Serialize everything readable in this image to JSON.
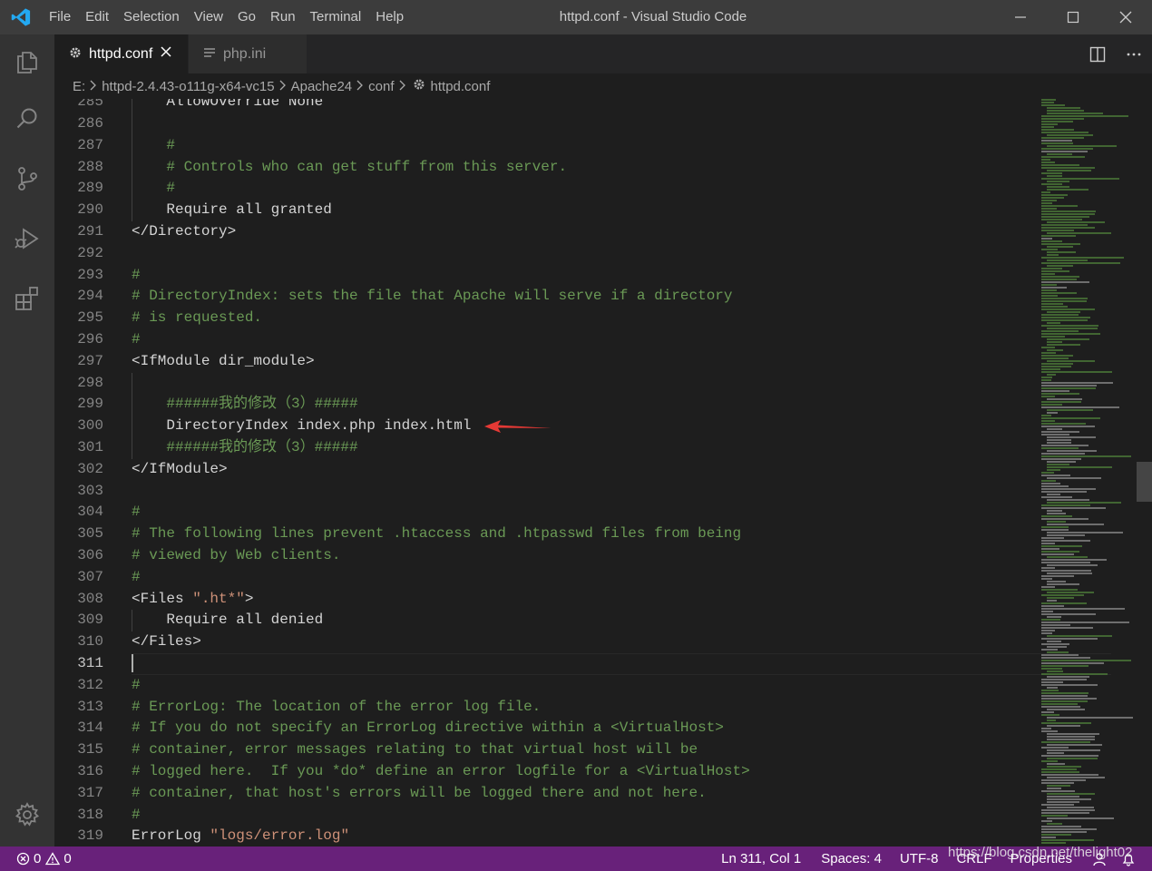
{
  "window": {
    "title": "httpd.conf - Visual Studio Code",
    "menu": [
      "File",
      "Edit",
      "Selection",
      "View",
      "Go",
      "Run",
      "Terminal",
      "Help"
    ]
  },
  "activity_bar": {
    "icons": [
      "explorer-icon",
      "search-icon",
      "source-control-icon",
      "run-debug-icon",
      "extensions-icon",
      "settings-gear-icon"
    ]
  },
  "tabs": [
    {
      "label": "httpd.conf",
      "active": true,
      "icon": "gear-file-icon"
    },
    {
      "label": "php.ini",
      "active": false,
      "icon": "lines-file-icon"
    }
  ],
  "breadcrumb": [
    "E:",
    "httpd-2.4.43-o111g-x64-vc15",
    "Apache24",
    "conf",
    "httpd.conf"
  ],
  "editor": {
    "first_line_partial": {
      "number": "285",
      "text": "AllowOverride None"
    },
    "lines": [
      {
        "n": "286",
        "indent": 0,
        "text": "",
        "kind": "code"
      },
      {
        "n": "287",
        "indent": 1,
        "text": "#",
        "kind": "comment"
      },
      {
        "n": "288",
        "indent": 1,
        "text": "# Controls who can get stuff from this server.",
        "kind": "comment"
      },
      {
        "n": "289",
        "indent": 1,
        "text": "#",
        "kind": "comment"
      },
      {
        "n": "290",
        "indent": 1,
        "text": "Require all granted",
        "kind": "code"
      },
      {
        "n": "291",
        "indent": 0,
        "text": "</Directory>",
        "kind": "code"
      },
      {
        "n": "292",
        "indent": 0,
        "text": "",
        "kind": "code"
      },
      {
        "n": "293",
        "indent": 0,
        "text": "#",
        "kind": "comment"
      },
      {
        "n": "294",
        "indent": 0,
        "text": "# DirectoryIndex: sets the file that Apache will serve if a directory",
        "kind": "comment"
      },
      {
        "n": "295",
        "indent": 0,
        "text": "# is requested.",
        "kind": "comment"
      },
      {
        "n": "296",
        "indent": 0,
        "text": "#",
        "kind": "comment"
      },
      {
        "n": "297",
        "indent": 0,
        "text": "<IfModule dir_module>",
        "kind": "code"
      },
      {
        "n": "298",
        "indent": 0,
        "text": "",
        "kind": "code"
      },
      {
        "n": "299",
        "indent": 1,
        "text": "######我的修改（3）#####",
        "kind": "comment"
      },
      {
        "n": "300",
        "indent": 1,
        "text": "DirectoryIndex index.php index.html",
        "kind": "code"
      },
      {
        "n": "301",
        "indent": 1,
        "text": "######我的修改（3）#####",
        "kind": "comment"
      },
      {
        "n": "302",
        "indent": 0,
        "text": "</IfModule>",
        "kind": "code"
      },
      {
        "n": "303",
        "indent": 0,
        "text": "",
        "kind": "code"
      },
      {
        "n": "304",
        "indent": 0,
        "text": "#",
        "kind": "comment"
      },
      {
        "n": "305",
        "indent": 0,
        "text": "# The following lines prevent .htaccess and .htpasswd files from being",
        "kind": "comment"
      },
      {
        "n": "306",
        "indent": 0,
        "text": "# viewed by Web clients.",
        "kind": "comment"
      },
      {
        "n": "307",
        "indent": 0,
        "text": "#",
        "kind": "comment"
      },
      {
        "n": "308",
        "indent": 0,
        "text": "<Files ",
        "str": "\".ht*\"",
        "after": ">",
        "kind": "mixed"
      },
      {
        "n": "309",
        "indent": 1,
        "text": "Require all denied",
        "kind": "code"
      },
      {
        "n": "310",
        "indent": 0,
        "text": "</Files>",
        "kind": "code"
      },
      {
        "n": "311",
        "indent": 0,
        "text": "",
        "kind": "code"
      },
      {
        "n": "312",
        "indent": 0,
        "text": "#",
        "kind": "comment"
      },
      {
        "n": "313",
        "indent": 0,
        "text": "# ErrorLog: The location of the error log file.",
        "kind": "comment"
      },
      {
        "n": "314",
        "indent": 0,
        "text": "# If you do not specify an ErrorLog directive within a <VirtualHost>",
        "kind": "comment"
      },
      {
        "n": "315",
        "indent": 0,
        "text": "# container, error messages relating to that virtual host will be",
        "kind": "comment"
      },
      {
        "n": "316",
        "indent": 0,
        "text": "# logged here.  If you *do* define an error logfile for a <VirtualHost>",
        "kind": "comment"
      },
      {
        "n": "317",
        "indent": 0,
        "text": "# container, that host's errors will be logged there and not here.",
        "kind": "comment"
      },
      {
        "n": "318",
        "indent": 0,
        "text": "#",
        "kind": "comment"
      },
      {
        "n": "319",
        "indent": 0,
        "text": "ErrorLog ",
        "str": "\"logs/error.log\"",
        "after": "",
        "kind": "mixed"
      }
    ],
    "cursor_line": "311"
  },
  "annotation": {
    "type": "red-arrow",
    "target_line": "300",
    "color": "#e53935"
  },
  "status_bar": {
    "errors": "0",
    "warnings": "0",
    "position": "Ln 311, Col 1",
    "spaces": "Spaces: 4",
    "encoding": "UTF-8",
    "eol": "CRLF",
    "language": "Properties",
    "watermark": "https://blog.csdn.net/thelight02"
  },
  "colors": {
    "status_bar": "#68217a",
    "comment": "#6a9955",
    "string": "#ce9178",
    "text": "#d4d4d4",
    "line_number": "#858585"
  }
}
